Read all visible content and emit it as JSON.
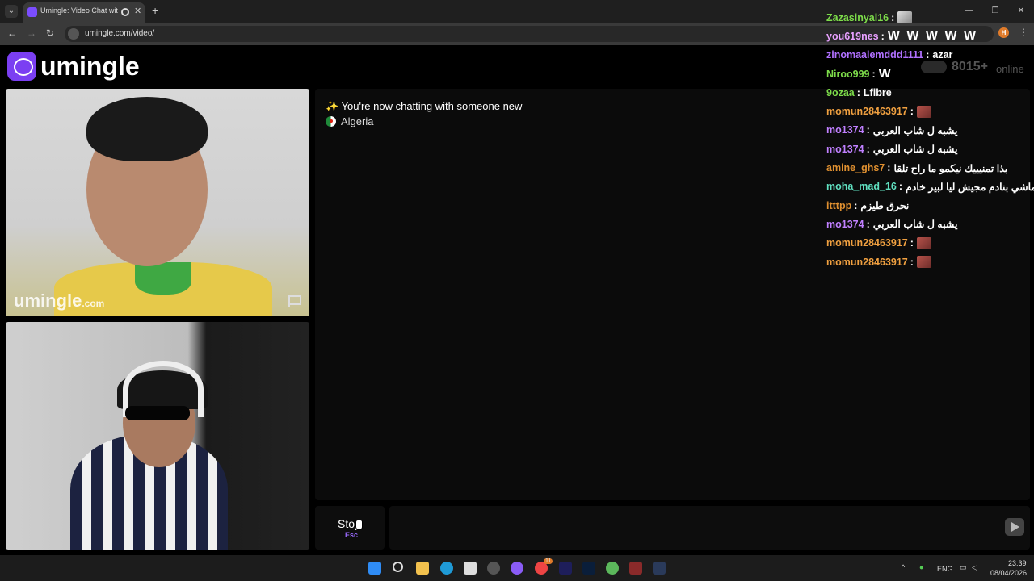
{
  "browser": {
    "tab_title": "Umingle: Video Chat with S",
    "tab_close": "✕",
    "new_tab": "+",
    "url": "umingle.com/video/",
    "extension_badge": "H"
  },
  "site": {
    "logo_text": "umingle",
    "watermark_main": "umingle",
    "watermark_suffix": ".com"
  },
  "chat": {
    "system_message": "✨ You're now chatting with someone new",
    "country": "Algeria"
  },
  "online": {
    "count": "8015+",
    "label": "online"
  },
  "stream_chat": [
    {
      "user": "Zazasinyal16",
      "color": "#7ddc4a",
      "message": "",
      "emote": "gray"
    },
    {
      "user": "you619nes",
      "color": "#e8a0ff",
      "message": "W W W W W",
      "emote": ""
    },
    {
      "user": "zinomaalemddd1111",
      "color": "#b070ff",
      "message": "azar",
      "emote": ""
    },
    {
      "user": "Niroo999",
      "color": "#7ddc4a",
      "message": "W",
      "emote": ""
    },
    {
      "user": "9ozaa",
      "color": "#7ddc4a",
      "message": "Lfibre",
      "emote": ""
    },
    {
      "user": "momun28463917",
      "color": "#f0a040",
      "message": "",
      "emote": "red"
    },
    {
      "user": "mo1374",
      "color": "#c080ff",
      "message": "يشبه ل شاب العربي",
      "emote": ""
    },
    {
      "user": "mo1374",
      "color": "#c080ff",
      "message": "يشبه ل شاب العربي",
      "emote": ""
    },
    {
      "user": "amine_ghs7",
      "color": "#e09030",
      "message": "بذا تمنيييك نيكمو ما راح تلقا",
      "emote": ""
    },
    {
      "user": "moha_mad_16",
      "color": "#60e0c0",
      "message": "انا ماشي بنادم مجيش ليا لبير خادم",
      "emote": ""
    },
    {
      "user": "itttpp",
      "color": "#e09030",
      "message": "نحرق طيزم",
      "emote": ""
    },
    {
      "user": "mo1374",
      "color": "#c080ff",
      "message": "يشبه ل شاب العربي",
      "emote": ""
    },
    {
      "user": "momun28463917",
      "color": "#f0a040",
      "message": "",
      "emote": "red"
    },
    {
      "user": "momun28463917",
      "color": "#f0a040",
      "message": "",
      "emote": "red"
    }
  ],
  "controls": {
    "stop_label": "Stop",
    "stop_key": "Esc",
    "message_placeholder": ""
  },
  "taskbar": {
    "language": "ENG",
    "time": "23:39",
    "date": "08/04/2026",
    "badge": "11"
  }
}
